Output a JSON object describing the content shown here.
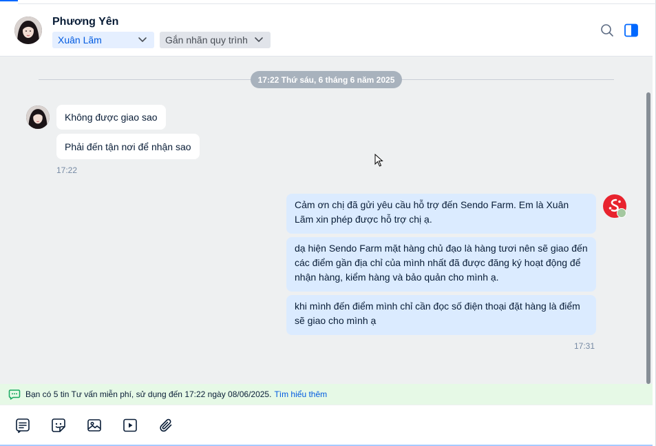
{
  "header": {
    "contact_name": "Phương Yên",
    "assignee": "Xuân Lãm",
    "process_label": "Gắn nhãn quy trình",
    "icons": {
      "avatar": "contact-avatar",
      "search": "search-icon",
      "panel": "side-panel-toggle-icon",
      "chevron": "chevron-down-icon"
    }
  },
  "chat": {
    "date_separator": "17:22 Thứ sáu, 6 tháng 6 năm 2025",
    "incoming": {
      "messages": [
        "Không được giao sao",
        "Phải đến tận nơi để nhận sao"
      ],
      "time": "17:22"
    },
    "outgoing": {
      "messages": [
        "Cảm ơn chị đã gửi yêu cầu hỗ trợ đến Sendo Farm. Em là Xuân Lãm xin phép được hỗ trợ chị ạ.",
        "dạ hiện Sendo Farm mặt hàng chủ đạo là hàng tươi nên sẽ giao đến các điểm gần địa chỉ của mình nhất đã được đăng ký hoạt động để nhận hàng, kiểm hàng và bảo quản cho mình ạ.",
        "khi mình đến điểm mình chỉ cần đọc số điện thoại đặt hàng là điểm sẽ giao cho mình ạ"
      ],
      "time": "17:31"
    }
  },
  "notice": {
    "text": "Bạn có 5 tin Tư vấn miễn phí, sử dụng đến 17:22 ngày 08/06/2025.",
    "link": "Tìm hiểu thêm"
  },
  "toolbar": {
    "tools": [
      "quick-message-icon",
      "sticker-icon",
      "image-icon",
      "video-icon",
      "attachment-icon"
    ]
  },
  "colors": {
    "accent": "#0068ff",
    "incoming_bubble": "#ffffff",
    "outgoing_bubble": "#dbebff",
    "chat_background": "#eef0f1",
    "notice_background": "#e6f9e6",
    "agent_avatar": "#e8232e"
  }
}
